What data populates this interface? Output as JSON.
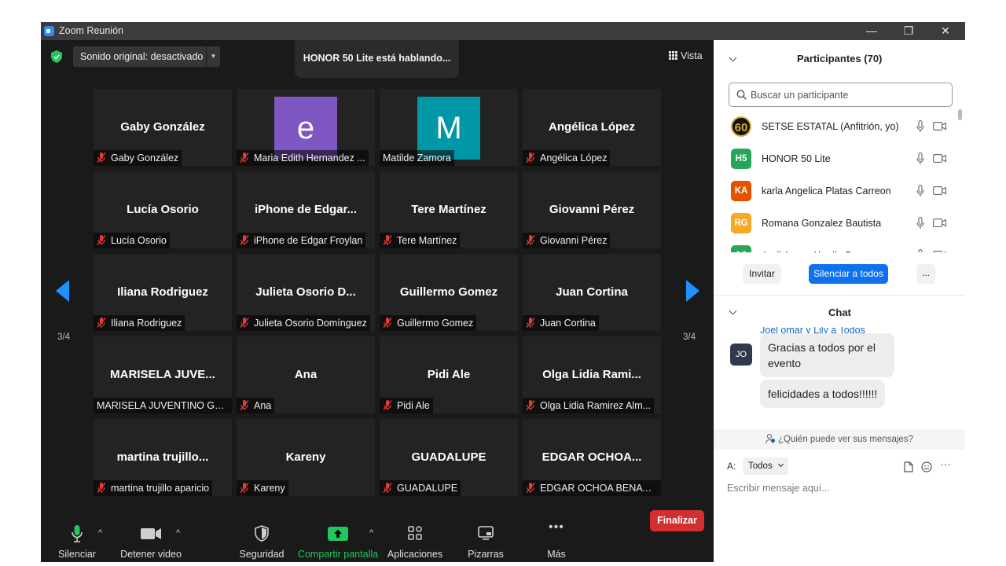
{
  "window": {
    "title": "Zoom Reunión",
    "controls": {
      "minimize": "—",
      "restore": "❐",
      "close": "✕"
    }
  },
  "video": {
    "audio_dropdown": "Sonido original: desactivado",
    "speaking_banner": "HONOR 50 Lite está hablando...",
    "view_button": "Vista",
    "page_left": "3/4",
    "page_right": "3/4",
    "tiles": [
      {
        "big": "Gaby González",
        "tag": "Gaby González",
        "muted": true
      },
      {
        "avatar_letter": "e",
        "avatar_color": "#7e57c2",
        "tag": "Maria Edith Hernandez ...",
        "muted": true
      },
      {
        "avatar_letter": "M",
        "avatar_color": "#0097a7",
        "tag": "Matilde Zamora",
        "muted": false
      },
      {
        "big": "Angélica López",
        "tag": "Angélica López",
        "muted": true
      },
      {
        "big": "Lucía Osorio",
        "tag": "Lucía Osorio",
        "muted": true
      },
      {
        "big": "iPhone  de  Edgar...",
        "tag": "iPhone de Edgar Froylan",
        "muted": true
      },
      {
        "big": "Tere Martínez",
        "tag": "Tere Martínez",
        "muted": true
      },
      {
        "big": "Giovanni Pérez",
        "tag": "Giovanni Pérez",
        "muted": true
      },
      {
        "big": "Iliana Rodriguez",
        "tag": "Iliana Rodriguez",
        "muted": true
      },
      {
        "big": "Julieta  Osorio  D...",
        "tag": "Julieta Osorio Domínguez",
        "muted": true
      },
      {
        "big": "Guillermo Gomez",
        "tag": "Guillermo Gomez",
        "muted": true
      },
      {
        "big": "Juan Cortina",
        "tag": "Juan Cortina",
        "muted": true
      },
      {
        "big": "MARISELA  JUVE...",
        "tag": "MARISELA JUVENTINO GU...",
        "muted": false
      },
      {
        "big": "Ana",
        "tag": "Ana",
        "muted": true
      },
      {
        "big": "Pidi Ale",
        "tag": "Pidi Ale",
        "muted": true
      },
      {
        "big": "Olga  Lidia  Rami...",
        "tag": "Olga Lidia Ramirez Alm...",
        "muted": true
      },
      {
        "big": "martina  trujillo...",
        "tag": "martina trujillo aparicio",
        "muted": true
      },
      {
        "big": "Kareny",
        "tag": "Kareny",
        "muted": true
      },
      {
        "big": "GUADALUPE",
        "tag": "GUADALUPE",
        "muted": true
      },
      {
        "big": "EDGAR  OCHOA...",
        "tag": "EDGAR OCHOA BENAVI...",
        "muted": true
      }
    ]
  },
  "toolbar": {
    "mute": "Silenciar",
    "video": "Detener video",
    "security": "Seguridad",
    "share": "Compartir pantalla",
    "apps": "Aplicaciones",
    "whiteboards": "Pizarras",
    "more": "Más",
    "end": "Finalizar",
    "share_color": "#22c55e",
    "end_color": "#d32f2f"
  },
  "participants": {
    "title": "Participantes (70)",
    "search_placeholder": "Buscar un participante",
    "list": [
      {
        "initials": "60",
        "name": "SETSE ESTATAL (Anfitrión, yo)",
        "color": "#1a1a1a"
      },
      {
        "initials": "H5",
        "name": "HONOR 50 Lite",
        "color": "#26a65b"
      },
      {
        "initials": "KA",
        "name": "karla Angelica  Platas Carreon",
        "color": "#e65100"
      },
      {
        "initials": "RG",
        "name": "Romana Gonzalez Bautista",
        "color": "#f9a825"
      },
      {
        "initials": "AA",
        "name": "Aroli Aaron  Abadia Ponce",
        "color": "#26a65b"
      }
    ],
    "invite": "Invitar",
    "mute_all": "Silenciar a todos",
    "more": "..."
  },
  "chat": {
    "title": "Chat",
    "sender": "Joel omar y Lily a Todos",
    "sender_initials": "JO",
    "messages": [
      "Gracias a todos  por el evento",
      "felicidades a todos!!!!!!"
    ],
    "who_can_see": "¿Quién puede ver sus mensajes?",
    "to_label": "A:",
    "to_value": "Todos",
    "input_placeholder": "Escribir mensaje aquí..."
  }
}
